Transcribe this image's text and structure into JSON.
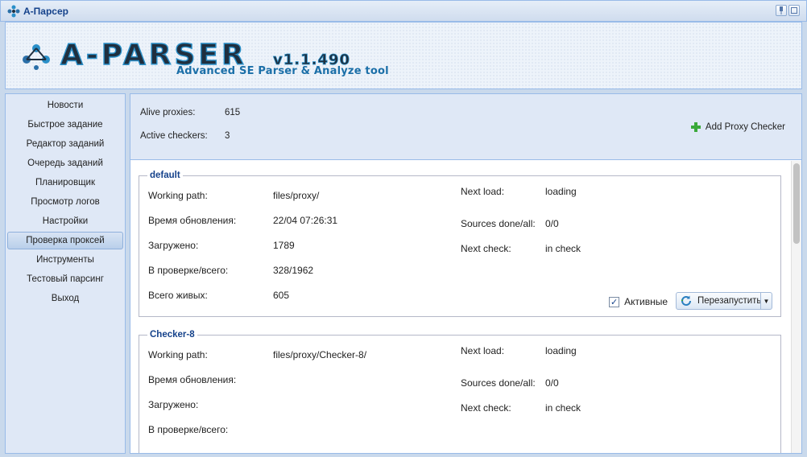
{
  "window": {
    "title": "A-Парсер"
  },
  "logo": {
    "name": "A-PARSER",
    "version": "v1.1.490",
    "subtitle": "Advanced SE Parser & Analyze tool"
  },
  "sidebar": {
    "items": [
      {
        "label": "Новости"
      },
      {
        "label": "Быстрое задание"
      },
      {
        "label": "Редактор заданий"
      },
      {
        "label": "Очередь заданий"
      },
      {
        "label": "Планировщик"
      },
      {
        "label": "Просмотр логов"
      },
      {
        "label": "Настройки"
      },
      {
        "label": "Проверка проксей",
        "active": true
      },
      {
        "label": "Инструменты"
      },
      {
        "label": "Тестовый парсинг"
      },
      {
        "label": "Выход"
      }
    ]
  },
  "summary": {
    "alive_label": "Alive proxies:",
    "alive_value": "615",
    "checkers_label": "Active checkers:",
    "checkers_value": "3",
    "add_button": "Add Proxy Checker"
  },
  "checkers": [
    {
      "name": "default",
      "working_path_label": "Working path:",
      "working_path": "files/proxy/",
      "updated_label": "Время обновления:",
      "updated": "22/04 07:26:31",
      "loaded_label": "Загружено:",
      "loaded": "1789",
      "in_check_label": "В проверке/всего:",
      "in_check": "328/1962",
      "alive_label": "Всего живых:",
      "alive": "605",
      "next_load_label": "Next load:",
      "next_load": "loading",
      "sources_label": "Sources done/all:",
      "sources": "0/0",
      "next_check_label": "Next check:",
      "next_check": "in check",
      "active_label": "Активные",
      "active_checked": true,
      "restart_label": "Перезапустить"
    },
    {
      "name": "Checker-8",
      "working_path_label": "Working path:",
      "working_path": "files/proxy/Checker-8/",
      "updated_label": "Время обновления:",
      "updated": "",
      "loaded_label": "Загружено:",
      "loaded": "",
      "in_check_label": "В проверке/всего:",
      "in_check": "",
      "next_load_label": "Next load:",
      "next_load": "loading",
      "sources_label": "Sources done/all:",
      "sources": "0/0",
      "next_check_label": "Next check:",
      "next_check": "in check"
    }
  ],
  "colors": {
    "accent": "#15428b",
    "border": "#99bbe8",
    "panel": "#dfe8f6",
    "logo_dark": "#1f2f3f",
    "logo_blue": "#2a8fc8"
  }
}
